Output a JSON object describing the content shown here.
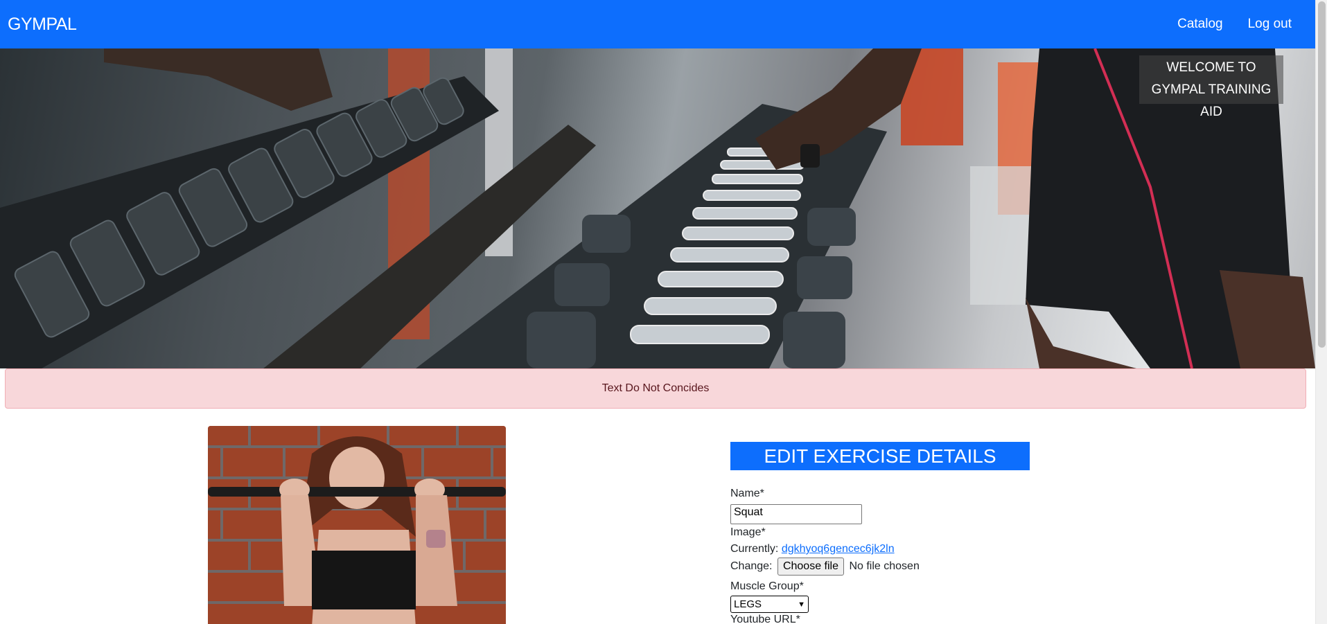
{
  "navbar": {
    "brand": "GYMPAL",
    "links": [
      "Catalog",
      "Log out"
    ]
  },
  "hero": {
    "welcome_text": "WELCOME TO GYMPAL TRAINING AID"
  },
  "alert": {
    "message": "Text Do Not Concides"
  },
  "form": {
    "title": "EDIT EXERCISE DETAILS",
    "name_label": "Name*",
    "name_value": "Squat",
    "image_label": "Image*",
    "currently_label": "Currently:",
    "currently_link": "dgkhyoq6gencec6jk2ln",
    "change_label": "Change:",
    "choose_file_label": "Choose file",
    "no_file_text": "No file chosen",
    "muscle_group_label": "Muscle Group*",
    "muscle_group_value": "LEGS",
    "youtube_label": "Youtube URL*"
  },
  "icons": {
    "select_arrow": "chevron-down-icon"
  },
  "colors": {
    "primary": "#0d6efd",
    "alert_bg": "#f8d7da",
    "alert_text": "#58151c"
  }
}
